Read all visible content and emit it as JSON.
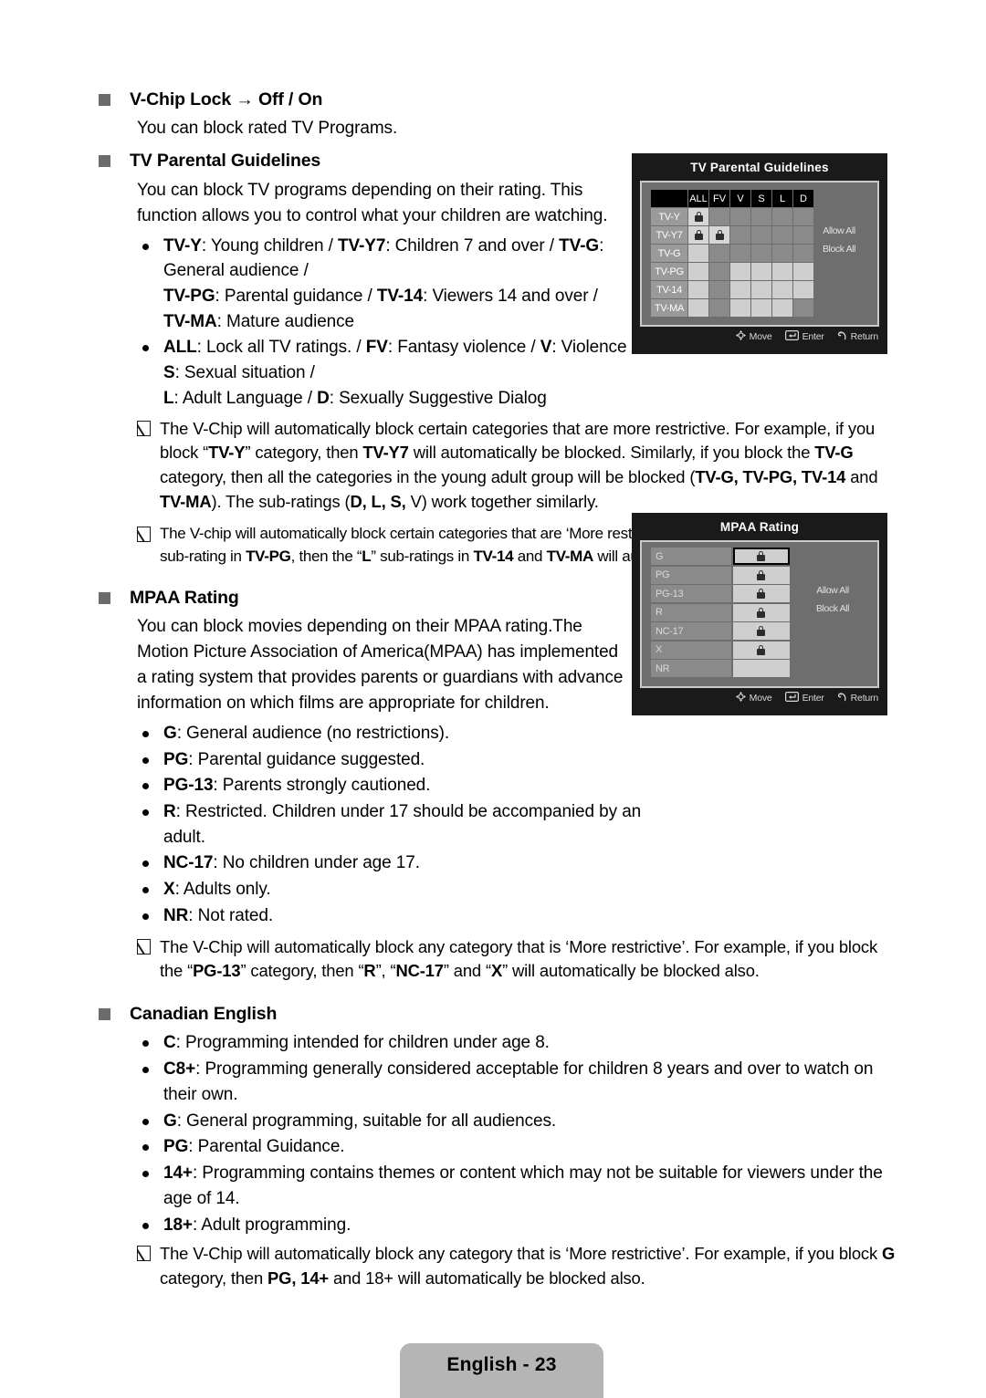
{
  "page": {
    "footer_label": "English - 23"
  },
  "sections": {
    "vchip": {
      "heading": "V-Chip Lock → Off / On",
      "paragraph": "You can block rated TV Programs."
    },
    "tv_parental": {
      "heading": "TV Parental Guidelines",
      "paragraph": "You can block TV programs depending on their rating. This function allows you to control what your children are watching.",
      "bullets": [
        "TV-Y: Young children / TV-Y7: Children 7 and over / TV-G: General audience / TV-PG: Parental guidance / TV-14: Viewers 14 and over / TV-MA: Mature audience",
        "ALL: Lock all TV ratings. / FV: Fantasy violence / V: Violence / S: Sexual situation / L: Adult Language / D: Sexually Suggestive Dialog"
      ],
      "notes": [
        "The V-Chip will automatically block certain categories that are more restrictive. For example, if you block “TV-Y” category, then TV-Y7 will automatically be blocked. Similarly, if you block the TV-G category, then all the categories in the young adult group will be blocked (TV-G, TV-PG, TV-14 and TV-MA). The sub-ratings (D, L, S, V) work together similarly.",
        "The V-chip will automatically block certain categories that are ‘More restrictive’. For example, if you block “L” sub-rating in TV-PG, then the “L” sub-ratings in TV-14 and TV-MA will automatically be blocked."
      ]
    },
    "mpaa": {
      "heading": "MPAA Rating",
      "paragraph": "You can block movies depending on their MPAA rating.The Motion Picture Association of America(MPAA) has implemented a rating system that provides parents or guardians with advance information on which films are appropriate for children.",
      "bullets": [
        "G: General audience (no restrictions).",
        "PG: Parental guidance suggested.",
        "PG-13: Parents strongly cautioned.",
        "R: Restricted. Children under 17 should be accompanied by an adult.",
        "NC-17: No children under age 17.",
        "X: Adults only.",
        "NR: Not rated."
      ],
      "notes": [
        "The V-Chip will automatically block any category that is ‘More restrictive’. For example, if you block the “PG-13” category, then “R”, “NC-17” and “X” will automatically be blocked also."
      ]
    },
    "canadian_english": {
      "heading": "Canadian English",
      "bullets": [
        "C: Programming intended for children under age 8.",
        "C8+: Programming generally considered acceptable for children 8 years and over to watch on their own.",
        "G: General programming, suitable for all audiences.",
        "PG: Parental Guidance.",
        "14+: Programming contains themes or content which may not be suitable for viewers under the age of 14.",
        "18+: Adult programming."
      ],
      "notes": [
        "The V-Chip will automatically block any category that is ‘More restrictive’. For example, if you block G category, then PG, 14+ and 18+ will automatically be blocked also."
      ]
    }
  },
  "osd_tv_parental": {
    "title": "TV Parental Guidelines",
    "column_headers": [
      "ALL",
      "FV",
      "V",
      "S",
      "L",
      "D"
    ],
    "row_headers": [
      "TV-Y",
      "TV-Y7",
      "TV-G",
      "TV-PG",
      "TV-14",
      "TV-MA"
    ],
    "cells": [
      [
        "lock",
        "dim",
        "dim",
        "dim",
        "dim",
        "dim"
      ],
      [
        "lock",
        "lock",
        "dim",
        "dim",
        "dim",
        "dim"
      ],
      [
        "lit",
        "dim",
        "dim",
        "dim",
        "dim",
        "dim"
      ],
      [
        "lit",
        "dim",
        "lit",
        "lit",
        "lit",
        "lit"
      ],
      [
        "lit",
        "dim",
        "lit",
        "lit",
        "lit",
        "lit"
      ],
      [
        "lit",
        "dim",
        "lit",
        "lit",
        "lit",
        "dim"
      ]
    ],
    "side_buttons": [
      "Allow All",
      "Block All"
    ],
    "footer": [
      {
        "icon": "dpad-icon",
        "label": "Move"
      },
      {
        "icon": "enter-icon",
        "label": "Enter"
      },
      {
        "icon": "return-icon",
        "label": "Return"
      }
    ]
  },
  "osd_mpaa": {
    "title": "MPAA Rating",
    "rows": [
      {
        "label": "G",
        "locked": true,
        "selected": true
      },
      {
        "label": "PG",
        "locked": true,
        "selected": false
      },
      {
        "label": "PG-13",
        "locked": true,
        "selected": false
      },
      {
        "label": "R",
        "locked": true,
        "selected": false
      },
      {
        "label": "NC-17",
        "locked": true,
        "selected": false
      },
      {
        "label": "X",
        "locked": true,
        "selected": false
      },
      {
        "label": "NR",
        "locked": false,
        "selected": false
      }
    ],
    "side_buttons": [
      "Allow All",
      "Block All"
    ],
    "footer": [
      {
        "icon": "dpad-icon",
        "label": "Move"
      },
      {
        "icon": "enter-icon",
        "label": "Enter"
      },
      {
        "icon": "return-icon",
        "label": "Return"
      }
    ]
  }
}
